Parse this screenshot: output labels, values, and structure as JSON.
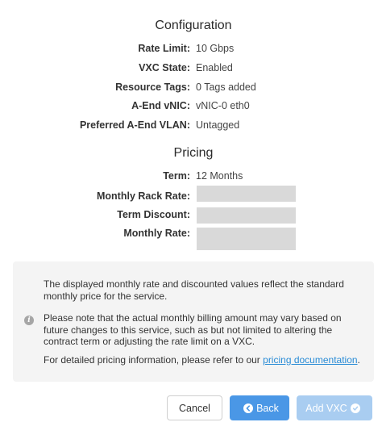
{
  "configuration": {
    "title": "Configuration",
    "rows": [
      {
        "label": "Rate Limit:",
        "value": "10 Gbps"
      },
      {
        "label": "VXC State:",
        "value": "Enabled"
      },
      {
        "label": "Resource Tags:",
        "value": "0 Tags added"
      },
      {
        "label": "A-End vNIC:",
        "value": "vNIC-0 eth0"
      },
      {
        "label": "Preferred A-End VLAN:",
        "value": "Untagged"
      }
    ]
  },
  "pricing": {
    "title": "Pricing",
    "term_label": "Term:",
    "term_value": "12 Months",
    "monthly_rack_rate_label": "Monthly Rack Rate:",
    "term_discount_label": "Term Discount:",
    "monthly_rate_label": "Monthly Rate:"
  },
  "info": {
    "p1": "The displayed monthly rate and discounted values reflect the standard monthly price for the service.",
    "p2": "Please note that the actual monthly billing amount may vary based on future changes to this service, such as but not limited to altering the contract term or adjusting the rate limit on a VXC.",
    "p3_prefix": "For detailed pricing information, please refer to our ",
    "p3_link": "pricing documentation",
    "p3_suffix": "."
  },
  "buttons": {
    "cancel": "Cancel",
    "back": "Back",
    "add": "Add VXC"
  },
  "colors": {
    "primary": "#4a97e6",
    "primary_disabled": "#a9cdf1",
    "link": "#2a8cd6",
    "skeleton": "#d9d9d9"
  }
}
